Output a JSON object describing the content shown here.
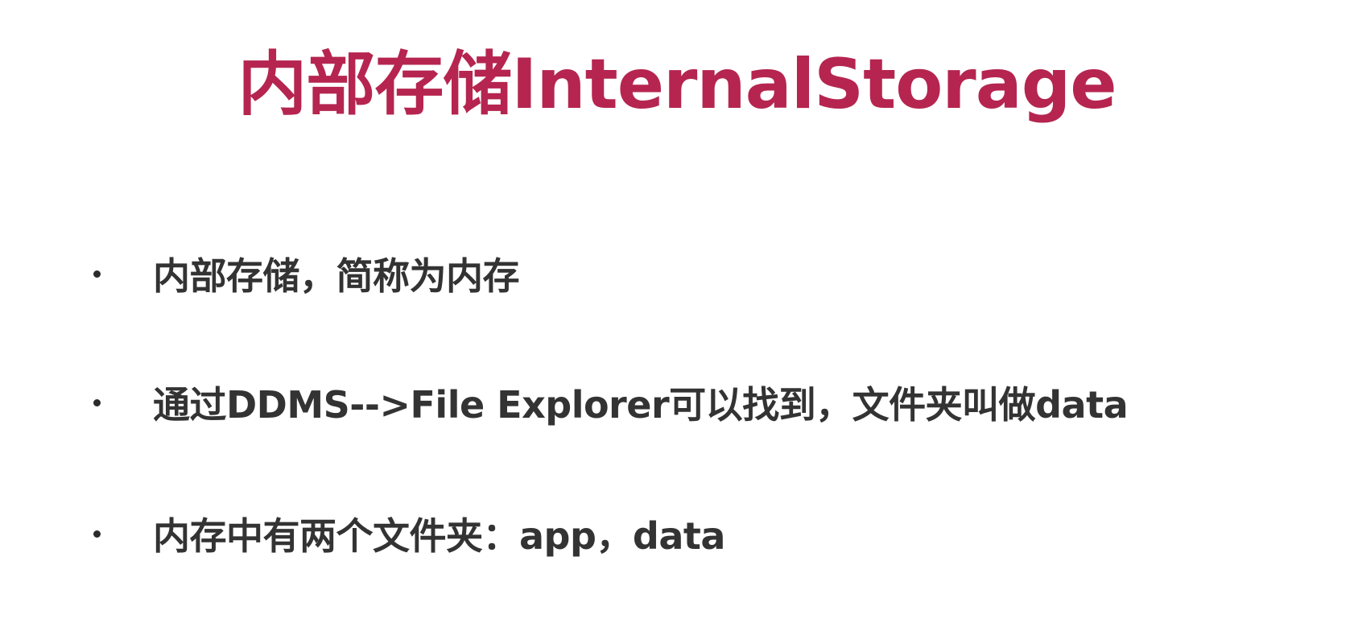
{
  "title": "内部存储InternalStorage",
  "bullets": [
    {
      "text": "内部存储，简称为内存"
    },
    {
      "text": "通过DDMS-->File Explorer可以找到，文件夹叫做data"
    },
    {
      "text": "内存中有两个文件夹：app，data"
    }
  ],
  "colors": {
    "title": "#b52550",
    "body_text": "#333333",
    "background": "#ffffff"
  }
}
